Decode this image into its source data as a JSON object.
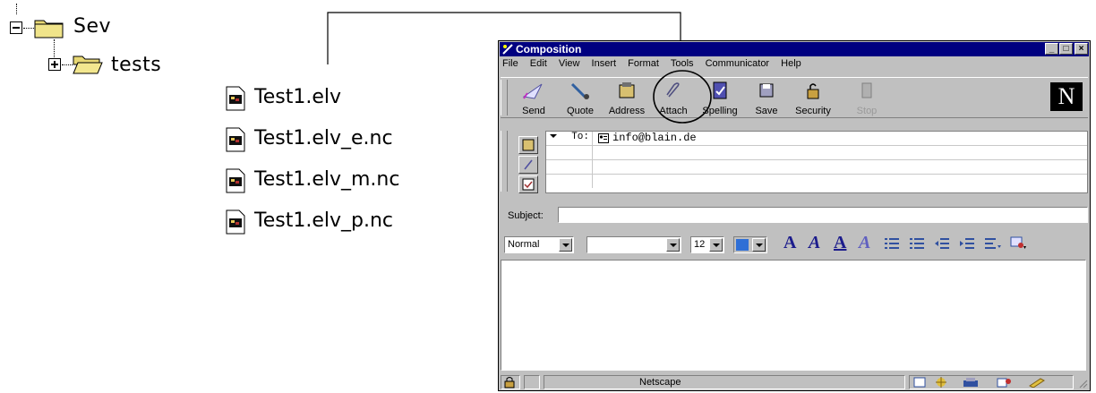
{
  "tree": {
    "root_label": "Sev",
    "child_label": "tests",
    "files": [
      "Test1.elv",
      "Test1.elv_e.nc",
      "Test1.elv_m.nc",
      "Test1.elv_p.nc"
    ]
  },
  "window": {
    "title": "Composition",
    "menu": [
      "File",
      "Edit",
      "View",
      "Insert",
      "Format",
      "Tools",
      "Communicator",
      "Help"
    ],
    "toolbar": [
      "Send",
      "Quote",
      "Address",
      "Attach",
      "Spelling",
      "Save",
      "Security",
      "Stop"
    ],
    "logo": "N",
    "to_label": "To:",
    "recipient": "info@blain.de",
    "subject_label": "Subject:",
    "format": {
      "style": "Normal",
      "font": "",
      "size": "12"
    },
    "status_text": "Netscape"
  },
  "colors": {
    "title_bar": "#000080",
    "window_face": "#c0c0c0",
    "folder": "#e8d874",
    "highlight_blue": "#2f6fd6"
  }
}
